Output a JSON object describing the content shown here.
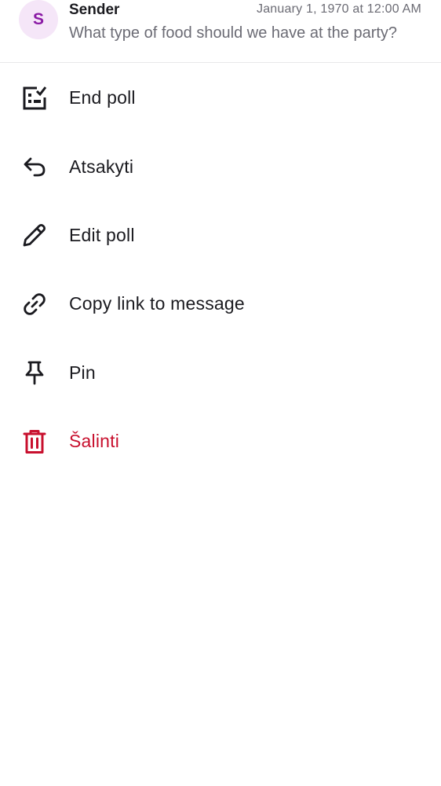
{
  "message": {
    "avatar_initial": "S",
    "sender": "Sender",
    "timestamp": "January 1, 1970 at 12:00 AM",
    "preview": "What type of food should we have at the party?"
  },
  "menu": {
    "items": [
      {
        "label": "End poll",
        "icon": "poll-end-icon"
      },
      {
        "label": "Atsakyti",
        "icon": "reply-icon"
      },
      {
        "label": "Edit poll",
        "icon": "pencil-icon"
      },
      {
        "label": "Copy link to message",
        "icon": "link-icon"
      },
      {
        "label": "Pin",
        "icon": "pin-icon"
      },
      {
        "label": "Šalinti",
        "icon": "trash-icon"
      }
    ]
  },
  "colors": {
    "danger": "#c8102e",
    "avatar_bg": "#f5e6f8",
    "avatar_fg": "#8a1aa5",
    "text": "#1a1a1f",
    "muted": "#6b6b74"
  }
}
